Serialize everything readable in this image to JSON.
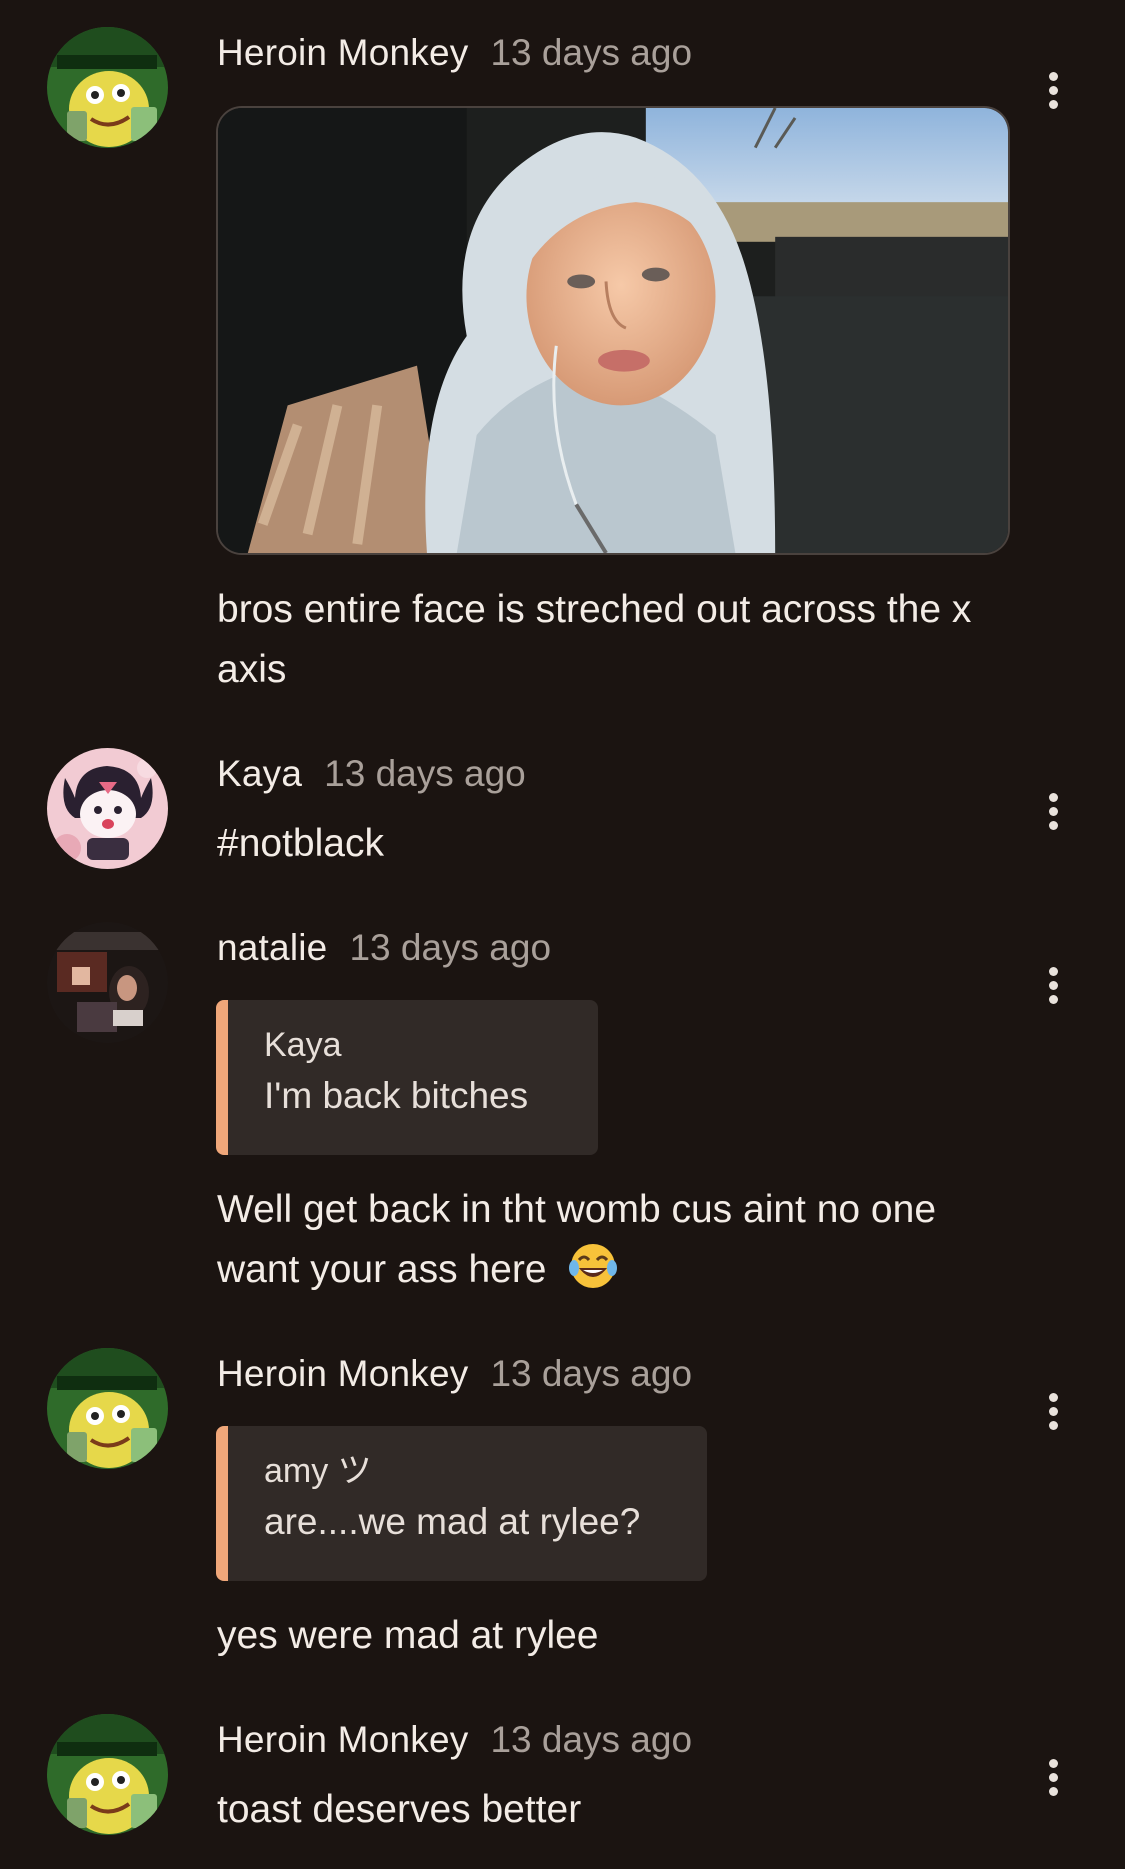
{
  "comments": [
    {
      "author": "Heroin Monkey",
      "time": "13 days ago",
      "avatar_icon": "green-cartoon-avatar-icon",
      "has_image": true,
      "text": "bros entire face is streched out across the x axis"
    },
    {
      "author": "Kaya",
      "time": "13 days ago",
      "avatar_icon": "pink-cartoon-avatar-icon",
      "text": "#notblack"
    },
    {
      "author": "natalie",
      "time": "13 days ago",
      "avatar_icon": "photo-avatar-icon",
      "quote": {
        "author": "Kaya",
        "text": "I'm back bitches"
      },
      "text": "Well get back in tht womb cus aint no one want your ass here",
      "emoji": "tears-of-joy-emoji"
    },
    {
      "author": "Heroin Monkey",
      "time": "13 days ago",
      "avatar_icon": "green-cartoon-avatar-icon",
      "quote": {
        "author": "amy ツ",
        "text": "are....we mad at rylee?"
      },
      "text": "yes were mad at rylee"
    },
    {
      "author": "Heroin Monkey",
      "time": "13 days ago",
      "avatar_icon": "green-cartoon-avatar-icon",
      "text": "toast deserves better"
    }
  ],
  "colors": {
    "background": "#1b1411",
    "quote_bar": "#f0a77a",
    "quote_bg": "#312a27",
    "timestamp": "#a9a09a"
  }
}
